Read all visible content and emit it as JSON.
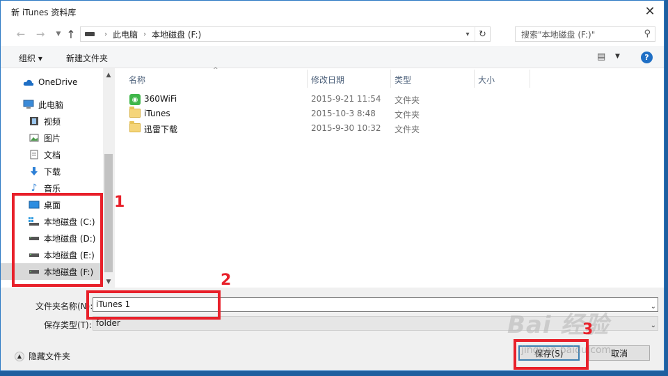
{
  "window": {
    "title": "新 iTunes 资料库"
  },
  "address": {
    "crumbs": [
      "此电脑",
      "本地磁盘 (F:)"
    ],
    "search_placeholder": "搜索\"本地磁盘 (F:)\""
  },
  "toolbar": {
    "organize": "组织 ▾",
    "new_folder": "新建文件夹"
  },
  "nav": {
    "items": [
      {
        "label": "OneDrive",
        "icon": "cloud-icon"
      },
      {
        "label": "此电脑",
        "icon": "computer-icon"
      },
      {
        "label": "视频",
        "icon": "video-icon"
      },
      {
        "label": "图片",
        "icon": "picture-icon"
      },
      {
        "label": "文档",
        "icon": "document-icon"
      },
      {
        "label": "下载",
        "icon": "download-icon"
      },
      {
        "label": "音乐",
        "icon": "music-icon"
      },
      {
        "label": "桌面",
        "icon": "desktop-icon"
      },
      {
        "label": "本地磁盘 (C:)",
        "icon": "drive-icon"
      },
      {
        "label": "本地磁盘 (D:)",
        "icon": "drive-icon"
      },
      {
        "label": "本地磁盘 (E:)",
        "icon": "drive-icon"
      },
      {
        "label": "本地磁盘 (F:)",
        "icon": "drive-icon"
      }
    ]
  },
  "columns": {
    "name": "名称",
    "modified": "修改日期",
    "type": "类型",
    "size": "大小"
  },
  "files": [
    {
      "name": "360WiFi",
      "modified": "2015-9-21 11:54",
      "type": "文件夹",
      "icon": "wifi-app-icon"
    },
    {
      "name": "iTunes",
      "modified": "2015-10-3 8:48",
      "type": "文件夹",
      "icon": "folder-icon"
    },
    {
      "name": "迅雷下载",
      "modified": "2015-9-30 10:32",
      "type": "文件夹",
      "icon": "folder-icon"
    }
  ],
  "form": {
    "folder_name_label": "文件夹名称(N):",
    "folder_name_value": "iTunes 1",
    "save_type_label": "保存类型(T):",
    "save_type_value": "folder"
  },
  "footer": {
    "hide_folders": "隐藏文件夹",
    "save": "保存(S)",
    "cancel": "取消"
  },
  "annotations": {
    "one": "1",
    "two": "2",
    "three": "3"
  },
  "watermark": {
    "brand": "Bai 经验",
    "url": "jingyan.baidu.com"
  },
  "colors": {
    "annotation": "#e8202a",
    "accent": "#1f6fc5",
    "selected": "#d9d9d9"
  }
}
